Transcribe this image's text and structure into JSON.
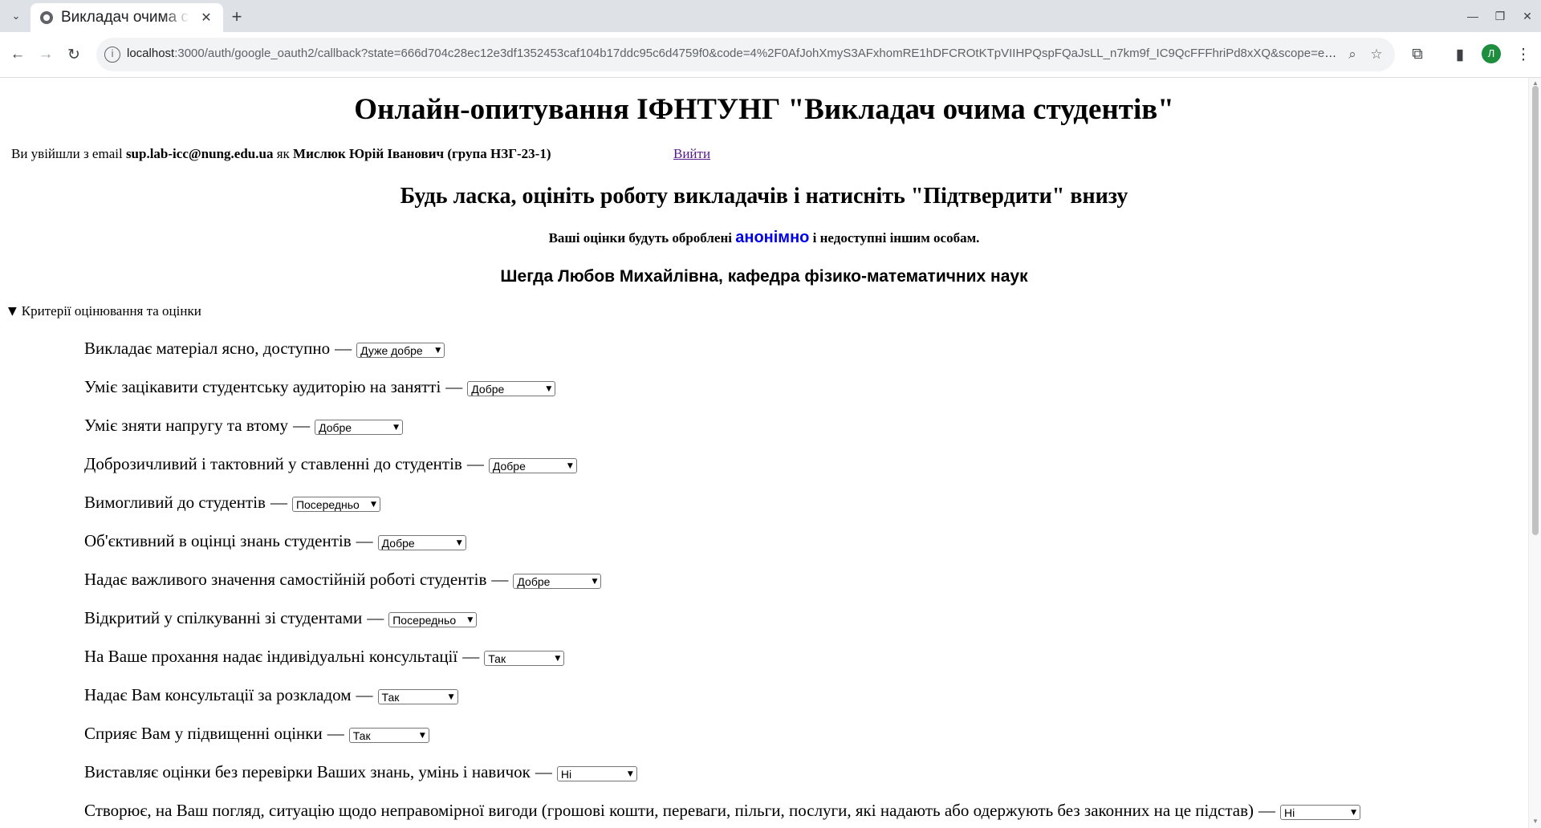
{
  "browser": {
    "tab_title": "Викладач очима студентів",
    "tab_list_icon": "chevron-down-icon",
    "new_tab_symbol": "+",
    "close_symbol": "✕",
    "url_host": "localhost",
    "url_rest": ":3000/auth/google_oauth2/callback?state=666d704c28ec12e3df1352453caf104b17ddc95c6d4759f0&code=4%2F0AfJohXmyS3AFxhomRE1hDFCROtKTpVIIHPQspFQaJsLL_n7km9f_IC9QcFFFhriPd8xXQ&scope=email+profi...",
    "profile_initial": "Л",
    "profile_color": "#1e8e3e"
  },
  "page": {
    "title": "Онлайн-опитування ІФНТУНГ \"Викладач очима студентів\"",
    "login_prefix": "Ви увійшли з email ",
    "login_email": "sup.lab-icc@nung.edu.ua",
    "login_as": " як ",
    "login_name": "Мислюк Юрій Іванович (група НЗГ-23-1)",
    "logout_label": "Вийти",
    "instruction": "Будь ласка, оцініть роботу викладачів і натисніть \"Підтвердити\" внизу",
    "anon_prefix": "Ваші оцінки будуть оброблені ",
    "anon_word": "анонімно",
    "anon_suffix": " і недоступні іншим особам.",
    "teacher": "Шегда Любов Михайлівна, кафедра фізико-математичних наук",
    "criteria_summary": "Критерії оцінювання та оцінки",
    "dash": "—"
  },
  "criteria": [
    {
      "label": "Викладає матеріал ясно, доступно",
      "value": "Дуже добре"
    },
    {
      "label": "Уміє зацікавити студентську аудиторію на занятті",
      "value": "Добре"
    },
    {
      "label": "Уміє зняти напругу та втому",
      "value": "Добре"
    },
    {
      "label": "Доброзичливий і тактовний у ставленні до студентів",
      "value": "Добре"
    },
    {
      "label": "Вимогливий до студентів",
      "value": "Посередньо"
    },
    {
      "label": "Об'єктивний в оцінці знань студентів",
      "value": "Добре"
    },
    {
      "label": "Надає важливого значення самостійній роботі студентів",
      "value": "Добре"
    },
    {
      "label": "Відкритий у спілкуванні зі студентами",
      "value": "Посередньо"
    },
    {
      "label": "На Ваше прохання надає індивідуальні консультації",
      "value": "Так"
    },
    {
      "label": "Надає Вам консультації за розкладом",
      "value": "Так"
    },
    {
      "label": "Сприяє Вам у підвищенні оцінки",
      "value": "Так"
    },
    {
      "label": "Виставляє оцінки без перевірки Ваших знань, умінь і навичок",
      "value": "Ні"
    },
    {
      "label": "Створює, на Ваш погляд, ситуацію щодо неправомірної вигоди (грошові кошти, переваги, пільги, послуги, які надають або одержують без законних на це підстав)",
      "value": "Ні"
    }
  ]
}
